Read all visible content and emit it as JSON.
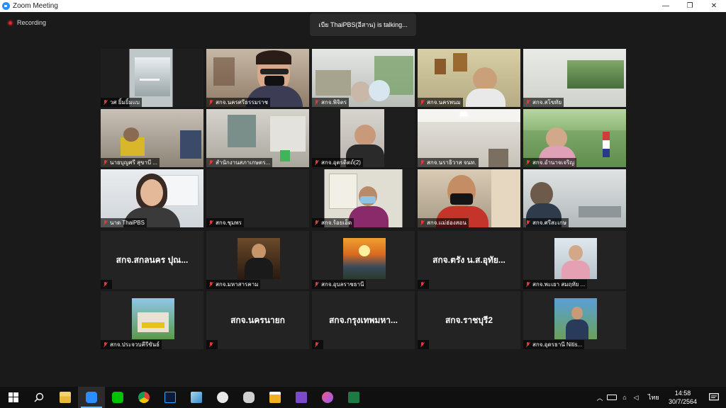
{
  "window": {
    "title": "Zoom Meeting",
    "controls": [
      "—",
      "❐",
      "✕"
    ]
  },
  "recording": {
    "label": "Recording"
  },
  "talking": {
    "text": "เบีย ThaiPBS(อีสาน) is  talking..."
  },
  "participants": [
    {
      "name": "วศ ยิ้มยิ้มแบ"
    },
    {
      "name": "สกจ.นครศรีธรรมราช"
    },
    {
      "name": "สกจ.พิจิตร"
    },
    {
      "name": "สกจ.นครพนม"
    },
    {
      "name": "สกจ.สโขทัย"
    },
    {
      "name": "นายบุญศรี สุขาบี ..."
    },
    {
      "name": "สำนักงานสภาเกษตร..."
    },
    {
      "name": "สกจ.อุตรดิตถ์(2)"
    },
    {
      "name": "สกจ.นราธิวาส จนท."
    },
    {
      "name": "สกจ.อำนาจเจริญ"
    },
    {
      "name": "นาด ThaiPBS"
    },
    {
      "name": "สกจ.ชุมพร"
    },
    {
      "name": "สกจ.ร้อยเอ็ด"
    },
    {
      "name": "สกจ.แม่ฮ่องสอน"
    },
    {
      "name": "สกจ.ศรีสะเกษ"
    },
    {
      "name": "",
      "display": "สกจ.สกลนคร ปุณ..."
    },
    {
      "name": "สกจ.มหาสารคาม"
    },
    {
      "name": "สกจ.อุบลราชธานี"
    },
    {
      "name": "",
      "display": "สกจ.ตรัง น.ส.อุทัย..."
    },
    {
      "name": "สกจ.พะเยา สมฤทัย ..."
    },
    {
      "name": "สกจ.ประจวบคีรีขันธ์"
    },
    {
      "name": "",
      "display": "สกจ.นครนายก"
    },
    {
      "name": "",
      "display": "สกจ.กรุงเทพมหา..."
    },
    {
      "name": "",
      "display": "สกจ.ราชบุรี2"
    },
    {
      "name": "สกจ.อุดรธานี Nitis..."
    }
  ],
  "taskbar": {
    "apps": [
      "start-icon",
      "search-icon",
      "file-explorer-icon",
      "zoom-icon",
      "line-icon",
      "chrome-icon",
      "photoshop-icon",
      "notepad-icon",
      "paint-icon",
      "camera-icon",
      "beer-icon",
      "visual-studio-icon",
      "itunes-icon",
      "excel-icon"
    ],
    "tray": {
      "language": "ไทย"
    },
    "clock": {
      "time": "14:58",
      "date": "30/7/2564"
    }
  },
  "colors": {
    "accent": "#2d8cff",
    "recording": "#e02828",
    "muted": "#e03a3a",
    "background": "#1a1a1a"
  }
}
